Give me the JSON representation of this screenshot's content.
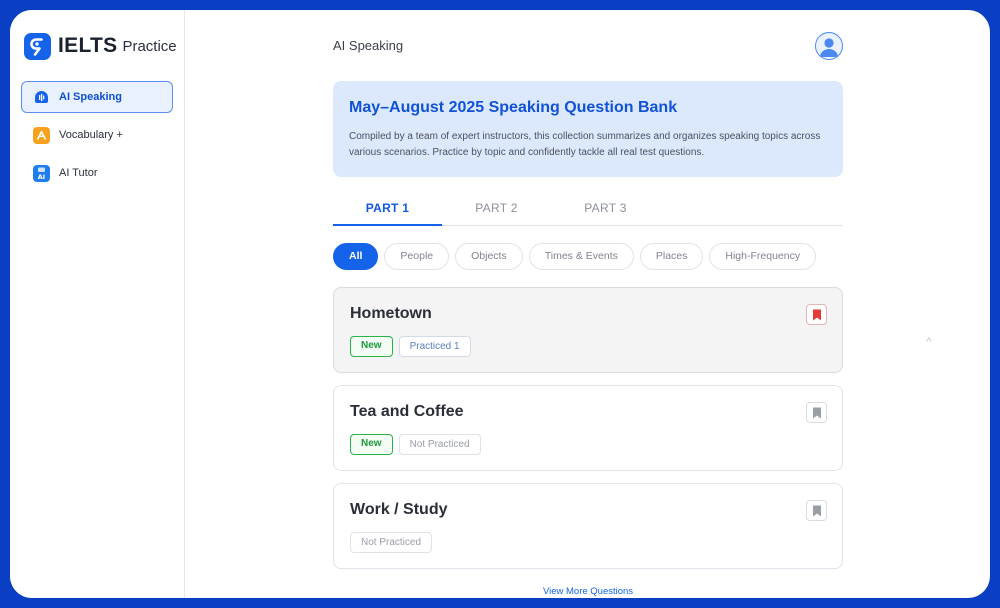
{
  "brand": {
    "name": "IELTS",
    "subtitle": "Practice"
  },
  "sidebar": {
    "items": [
      {
        "label": "AI Speaking",
        "icon": "speaking-icon",
        "active": true
      },
      {
        "label": "Vocabulary +",
        "icon": "vocabulary-icon",
        "active": false
      },
      {
        "label": "AI Tutor",
        "icon": "ai-tutor-icon",
        "active": false
      }
    ]
  },
  "header": {
    "title": "AI Speaking"
  },
  "banner": {
    "title": "May–August 2025 Speaking Question Bank",
    "description": "Compiled by a team of expert instructors, this collection summarizes and organizes speaking topics across various scenarios. Practice by topic and confidently tackle all real test questions."
  },
  "tabs": [
    {
      "label": "PART 1",
      "active": true
    },
    {
      "label": "PART 2",
      "active": false
    },
    {
      "label": "PART 3",
      "active": false
    }
  ],
  "filters": [
    {
      "label": "All",
      "active": true
    },
    {
      "label": "People",
      "active": false
    },
    {
      "label": "Objects",
      "active": false
    },
    {
      "label": "Times & Events",
      "active": false
    },
    {
      "label": "Places",
      "active": false
    },
    {
      "label": "High-Frequency",
      "active": false
    }
  ],
  "topics": [
    {
      "title": "Hometown",
      "tags": [
        "New",
        "Practiced 1"
      ],
      "bookmarked": true
    },
    {
      "title": "Tea and Coffee",
      "tags": [
        "New",
        "Not Practiced"
      ],
      "bookmarked": false
    },
    {
      "title": "Work / Study",
      "tags": [
        "Not Practiced"
      ],
      "bookmarked": false
    }
  ],
  "footer": {
    "view_more": "View More Questions"
  },
  "colors": {
    "frame": "#0a3fc4",
    "accent": "#1563e8",
    "banner_bg": "#dce9fd",
    "new_tag": "#26b34a",
    "bookmark_active": "#e53935"
  },
  "scroll_up_glyph": "^"
}
